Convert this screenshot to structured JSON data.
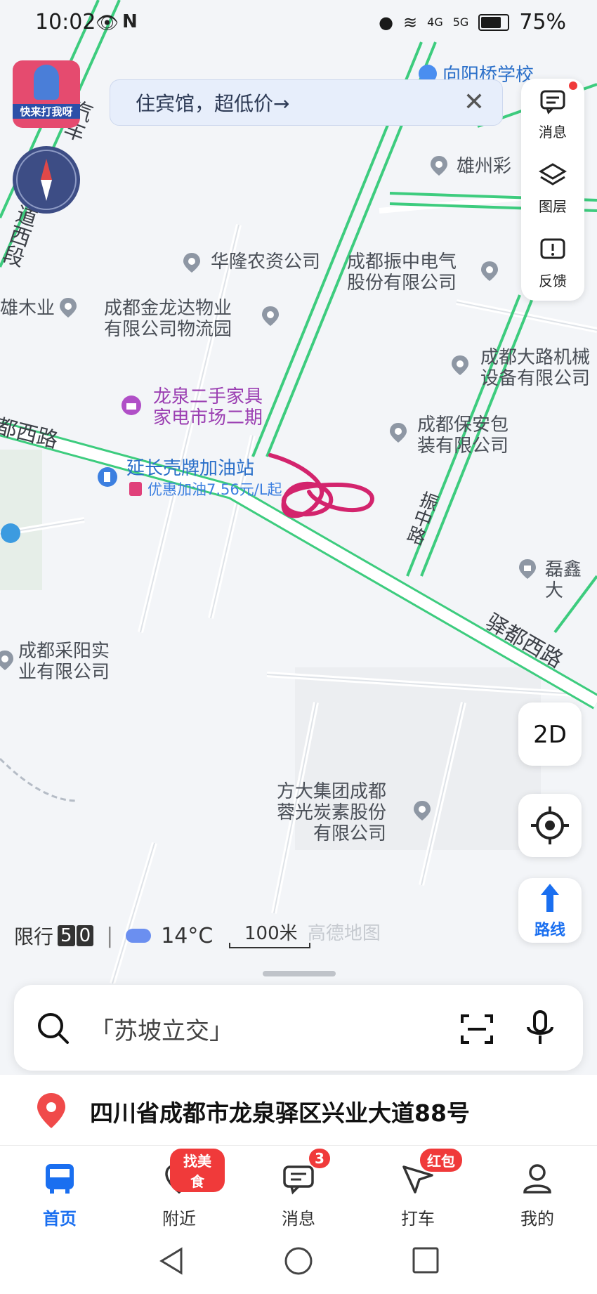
{
  "status_bar": {
    "time": "10:02",
    "battery": "75%",
    "network_4g": "4G",
    "network_5g": "5G"
  },
  "banner": {
    "text": "住宾馆，超低价→"
  },
  "ad_badge": {
    "text": "快来打我呀"
  },
  "side_panel": {
    "messages": "消息",
    "layers": "图层",
    "feedback": "反馈"
  },
  "map_controls": {
    "mode": "2D",
    "route": "路线"
  },
  "roads": {
    "qixing": "汽车",
    "ave_west": "大道西段",
    "yidu_west_1": "都西路",
    "yidu_west_2": "驿都西路",
    "zhenzhong": "振中路"
  },
  "pois": {
    "school": "向阳桥学校",
    "xiongzhou": "雄州彩",
    "hualong": "华隆农资公司",
    "zhenzhong_elec": "成都振中电气\n股份有限公司",
    "wood": "雄木业",
    "jinlongda": "成都金龙达物业\n有限公司物流园",
    "dalu": "成都大路机械\n设备有限公司",
    "secondhand": "龙泉二手家具\n家电市场二期",
    "baoan": "成都保安包\n装有限公司",
    "gas_station": "延长壳牌加油站",
    "gas_promo": "优惠加油7.56元/L起",
    "leixin": "磊鑫大",
    "caiyang": "成都采阳实\n业有限公司",
    "fangda": "方大集团成都\n蓉光炭素股份\n有限公司"
  },
  "info_row": {
    "limit_label": "限行",
    "limit_numbers": [
      "5",
      "0"
    ],
    "weather": "14°C",
    "scale": "100米",
    "watermark": "高德地图"
  },
  "search": {
    "placeholder": "「苏坡立交」"
  },
  "current_address": "四川省成都市龙泉驿区兴业大道88号",
  "tabs": [
    {
      "label": "首页",
      "badge": ""
    },
    {
      "label": "附近",
      "badge": "找美食"
    },
    {
      "label": "消息",
      "badge": "3"
    },
    {
      "label": "打车",
      "badge": "红包"
    },
    {
      "label": "我的",
      "badge": ""
    }
  ],
  "colors": {
    "road_green": "#3dcc7e",
    "accent_blue": "#1a6ff0",
    "badge_red": "#f03a3a",
    "scribble": "#d3246d"
  }
}
